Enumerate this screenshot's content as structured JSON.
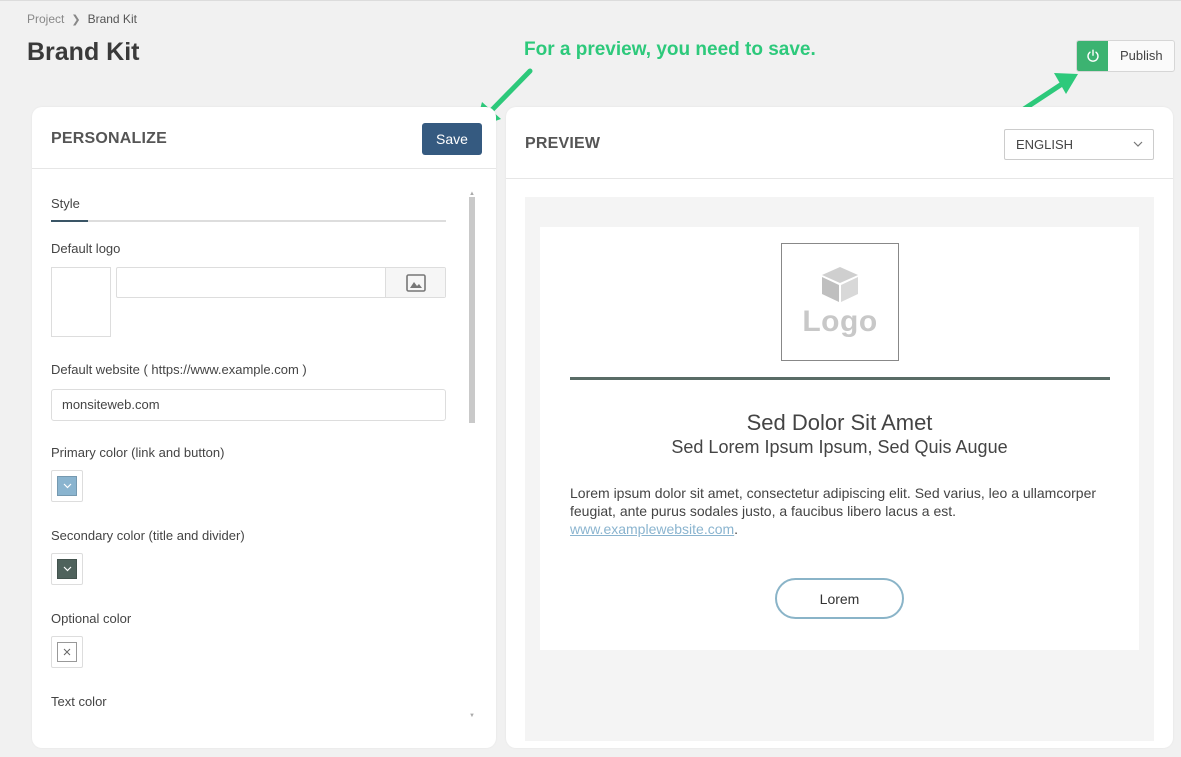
{
  "breadcrumb": {
    "parent": "Project",
    "current": "Brand Kit"
  },
  "page_title": "Brand Kit",
  "annotation": {
    "text": "For a preview, you need to save.",
    "color": "#2dc97b"
  },
  "publish": {
    "label": "Publish",
    "toggle_color": "#3cb371"
  },
  "personalize": {
    "title": "PERSONALIZE",
    "save_label": "Save",
    "tab_label": "Style",
    "default_logo_label": "Default logo",
    "logo_path_value": "",
    "website_label": "Default website ( https://www.example.com )",
    "website_value": "monsiteweb.com",
    "primary_color_label": "Primary color (link and button)",
    "primary_color": "#8ab4cf",
    "secondary_color_label": "Secondary color (title and divider)",
    "secondary_color": "#4f625c",
    "optional_color_label": "Optional color",
    "text_color_label": "Text color"
  },
  "preview": {
    "title": "PREVIEW",
    "language": "ENGLISH",
    "logo_placeholder": "Logo",
    "email_title": "Sed Dolor Sit Amet",
    "email_subtitle": "Sed Lorem Ipsum Ipsum, Sed Quis Augue",
    "paragraph": "Lorem ipsum dolor sit amet, consectetur adipiscing elit. Sed varius, leo a ullamcorper feugiat, ante purus sodales justo, a faucibus libero lacus a est.",
    "link_text": "www.examplewebsite.com",
    "link_suffix": ".",
    "button_label": "Lorem"
  },
  "colors": {
    "save_button": "#355a80",
    "divider": "#596c66"
  }
}
